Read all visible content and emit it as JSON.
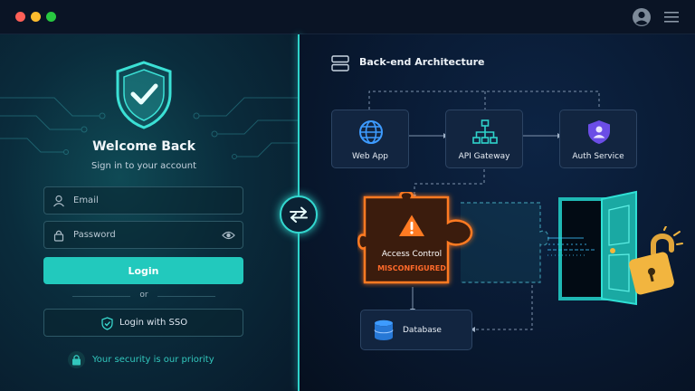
{
  "window": {
    "controls": [
      {
        "name": "close",
        "color": "#ff5f57"
      },
      {
        "name": "minimize",
        "color": "#febc2e"
      },
      {
        "name": "maximize",
        "color": "#28c840"
      }
    ],
    "icons": [
      "user-circle-icon",
      "hamburger-menu-icon"
    ]
  },
  "login": {
    "title": "Welcome Back",
    "subtitle": "Sign in to your account",
    "email_placeholder": "Email",
    "password_placeholder": "Password",
    "login_button": "Login",
    "or_text": "or",
    "sso_button": "Login with SSO",
    "security_note": "Your security is our priority",
    "accent_color": "#22c9bd"
  },
  "architecture": {
    "title": "Back-end Architecture",
    "nodes": {
      "web_app": "Web App",
      "api_gateway": "API Gateway",
      "auth_service": "Auth Service",
      "access_control": "Access Control",
      "access_control_status": "MISCONFIGURED",
      "database": "Database"
    },
    "warning_color": "#ff6a2a",
    "icons": [
      "globe-icon",
      "network-hub-icon",
      "auth-shield-icon",
      "warning-icon",
      "database-icon",
      "open-door-icon",
      "unlocked-padlock-icon"
    ]
  }
}
